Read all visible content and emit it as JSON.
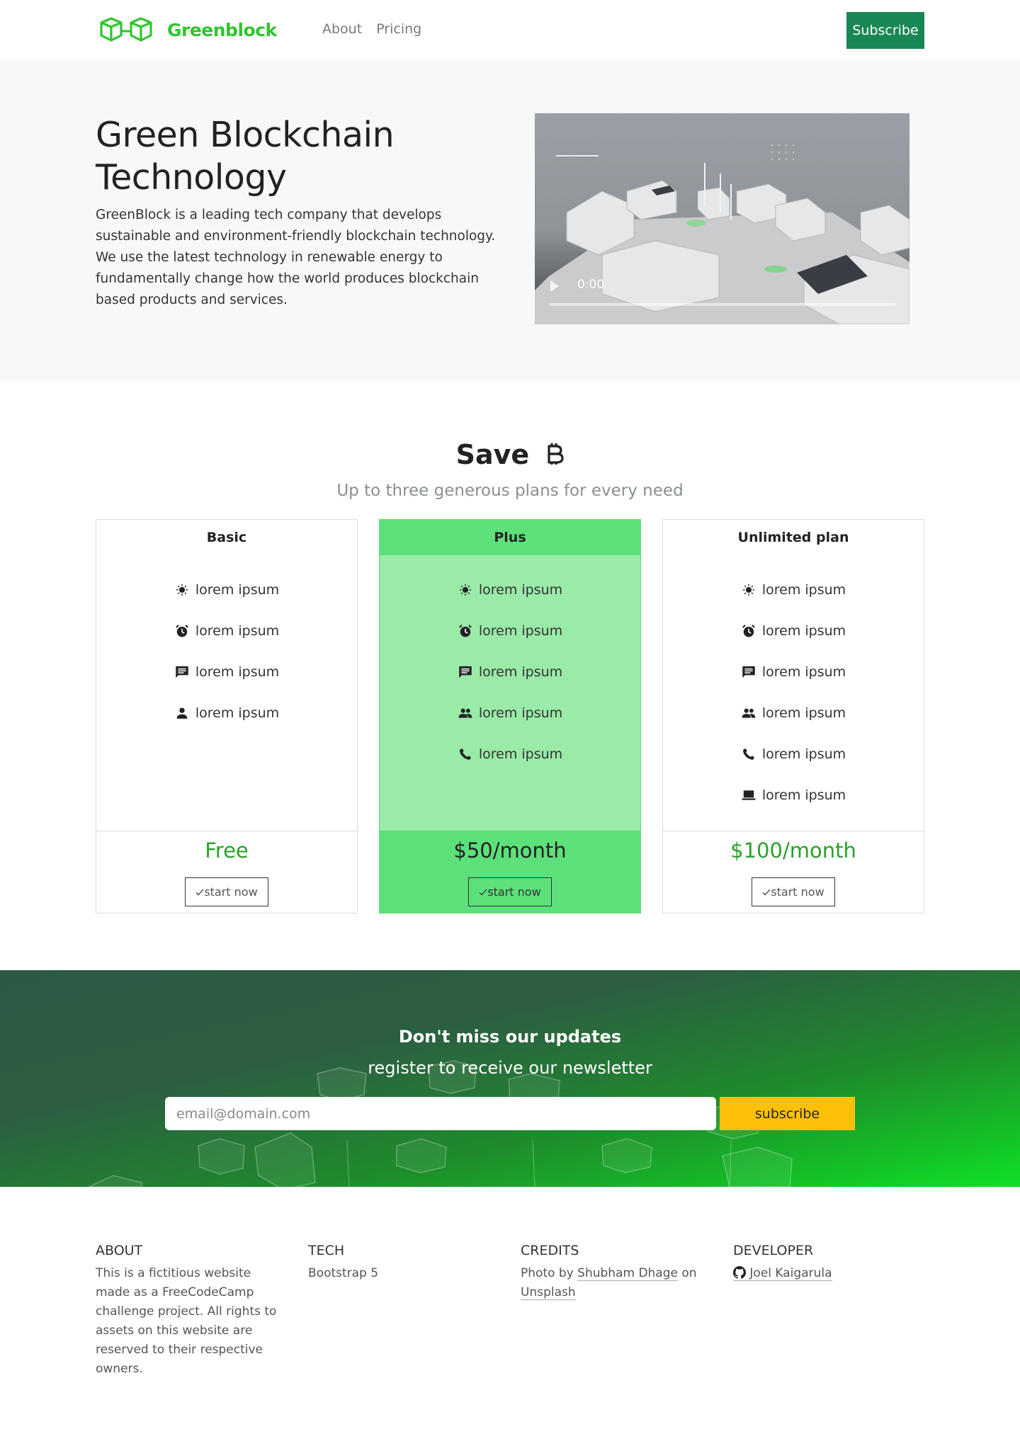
{
  "nav": {
    "brand": "Greenblock",
    "links": [
      "About",
      "Pricing"
    ],
    "subscribe_label": "Subscribe"
  },
  "hero": {
    "title": "Green Blockchain Technology",
    "text": "GreenBlock is a leading tech company that develops sustainable and environment-friendly blockchain technology. We use the latest technology in renewable energy to fundamentally change how the world produces blockchain based products and services.",
    "video_time": "0:00"
  },
  "pricing": {
    "title": "Save",
    "title_icon": "bitcoin-icon",
    "subtitle": "Up to three generous plans for every need",
    "plans": [
      {
        "name": "Basic",
        "features": [
          {
            "icon": "sun-icon",
            "label": "lorem ipsum"
          },
          {
            "icon": "alarm-icon",
            "label": "lorem ipsum"
          },
          {
            "icon": "chat-icon",
            "label": "lorem ipsum"
          },
          {
            "icon": "person-icon",
            "label": "lorem ipsum"
          }
        ],
        "price": "Free",
        "button": "start now"
      },
      {
        "name": "Plus",
        "features": [
          {
            "icon": "sun-icon",
            "label": "lorem ipsum"
          },
          {
            "icon": "alarm-icon",
            "label": "lorem ipsum"
          },
          {
            "icon": "chat-icon",
            "label": "lorem ipsum"
          },
          {
            "icon": "people-icon",
            "label": "lorem ipsum"
          },
          {
            "icon": "phone-icon",
            "label": "lorem ipsum"
          }
        ],
        "price": "$50/month",
        "button": "start now"
      },
      {
        "name": "Unlimited plan",
        "features": [
          {
            "icon": "sun-icon",
            "label": "lorem ipsum"
          },
          {
            "icon": "alarm-icon",
            "label": "lorem ipsum"
          },
          {
            "icon": "chat-icon",
            "label": "lorem ipsum"
          },
          {
            "icon": "people-icon",
            "label": "lorem ipsum"
          },
          {
            "icon": "phone-icon",
            "label": "lorem ipsum"
          },
          {
            "icon": "laptop-icon",
            "label": "lorem ipsum"
          }
        ],
        "price": "$100/month",
        "button": "start now"
      }
    ]
  },
  "newsletter": {
    "title": "Don't miss our updates",
    "subtitle": "register to receive our newsletter",
    "email_placeholder": "email@domain.com",
    "button": "subscribe"
  },
  "footer": {
    "about": {
      "heading": "ABOUT",
      "text_before": "This is a fictitious website made as a ",
      "link": "FreeCodeCamp",
      "text_after": " challenge project. All rights to assets on this website are reserved to their respective owners."
    },
    "tech": {
      "heading": "TECH",
      "text": "Bootstrap 5"
    },
    "credits": {
      "heading": "CREDITS",
      "prefix": "Photo by ",
      "author": "Shubham Dhage",
      "mid": " on",
      "site": "Unsplash"
    },
    "developer": {
      "heading": "DEVELOPER",
      "name": "Joel Kaigarula",
      "icon": "github-icon"
    }
  },
  "colors": {
    "brand_green": "#2ec62e",
    "subscribe_btn": "#198754",
    "plus_header": "#5ce07a",
    "plus_body": "#9aeaa8",
    "price_green": "#2aa12a",
    "newsletter_btn": "#ffc107"
  }
}
